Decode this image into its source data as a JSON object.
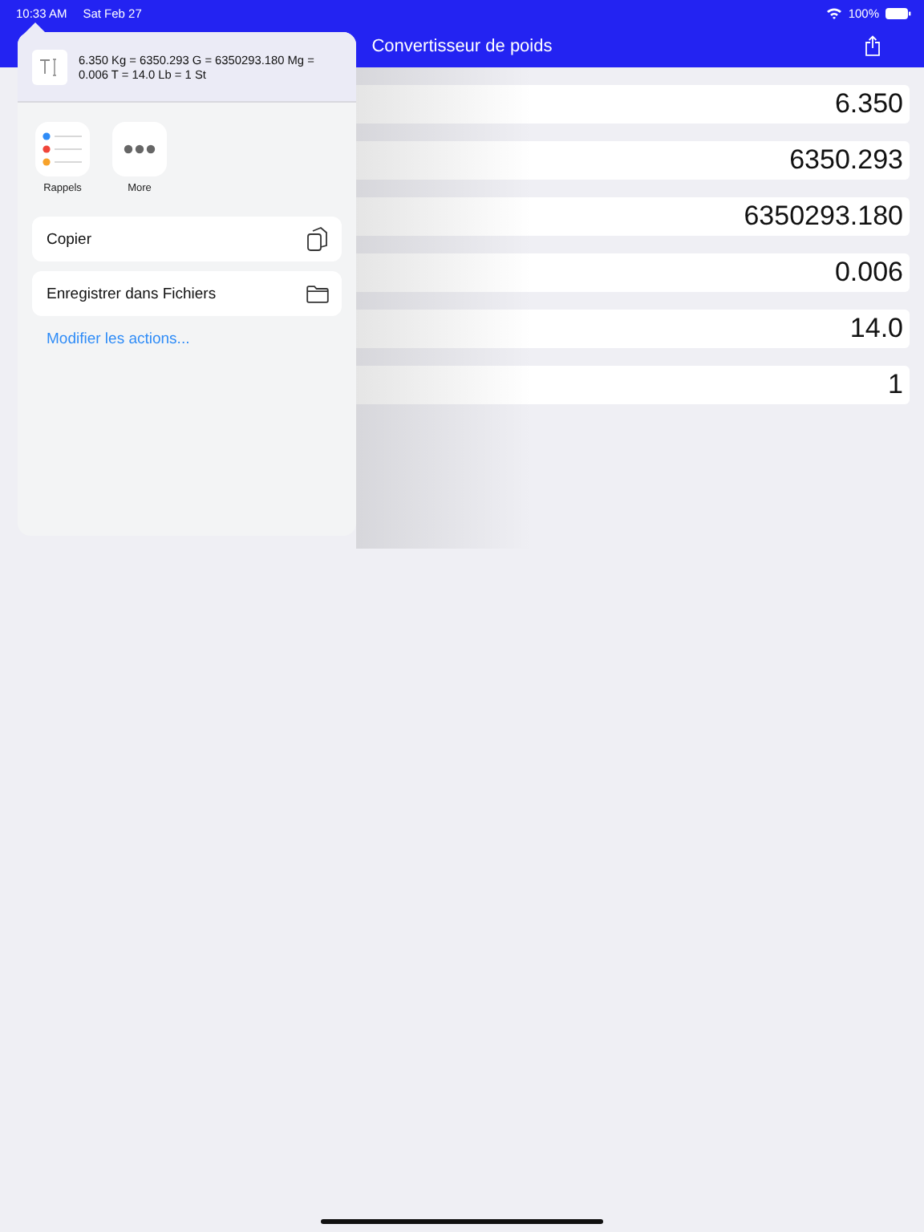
{
  "status_bar": {
    "time": "10:33 AM",
    "date": "Sat Feb 27",
    "battery": "100%"
  },
  "nav": {
    "title": "Convertisseur de poids"
  },
  "rows": [
    {
      "value": "6.350"
    },
    {
      "value": "6350.293"
    },
    {
      "value": "6350293.180"
    },
    {
      "value": "0.006"
    },
    {
      "value": "14.0"
    },
    {
      "value": "1"
    }
  ],
  "share_sheet": {
    "preview_text": "6.350 Kg = 6350.293 G = 6350293.180 Mg = 0.006 T = 14.0 Lb = 1 St",
    "apps": [
      {
        "kind": "reminders",
        "label": "Rappels"
      },
      {
        "kind": "more",
        "label": "More"
      }
    ],
    "actions": [
      {
        "kind": "copy",
        "label": "Copier"
      },
      {
        "kind": "folder",
        "label": "Enregistrer dans Fichiers"
      }
    ],
    "edit_link": "Modifier les actions..."
  }
}
